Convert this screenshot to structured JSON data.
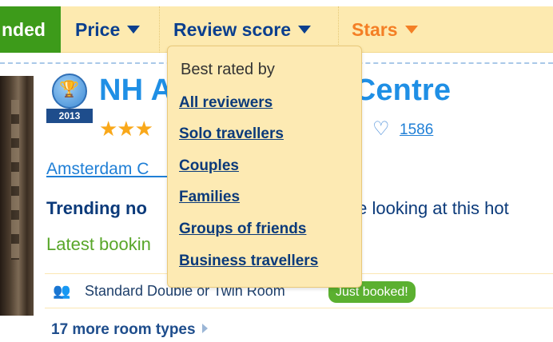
{
  "sort_bar": {
    "recommended_label": "nded",
    "price_label": "Price",
    "review_label": "Review score",
    "stars_label": "Stars"
  },
  "hotel": {
    "award_year": "2013",
    "name_visible": "NH A                ity Centre",
    "stars": "★★★",
    "favourites_count": "1586",
    "address": "Amsterdam C                          am",
    "trending_label": "Trending no",
    "trending_suffix": "ple looking at this hot",
    "latest_booking": "Latest bookin",
    "room": {
      "name": "Standard Double or Twin Room",
      "badge": "Just booked!"
    },
    "more_rooms": "17 more room types"
  },
  "dropdown": {
    "title": "Best rated by",
    "items": [
      "All reviewers",
      "Solo travellers",
      "Couples",
      "Families",
      "Groups of friends",
      "Business travellers"
    ]
  },
  "icons": {
    "award": "trophy-icon",
    "heart": "heart-icon",
    "occupancy": "people-icon",
    "caret": "caret-down-icon",
    "more": "chevron-right-icon"
  },
  "colors": {
    "sort_bar_bg": "#fdeab0",
    "recommended_bg": "#3d9b1a",
    "link_blue": "#1f7fd6",
    "stars_orange": "#f47f25",
    "booked_green": "#5bb030"
  }
}
